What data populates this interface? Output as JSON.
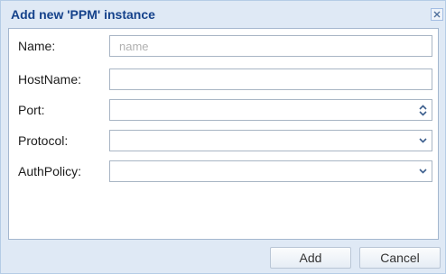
{
  "dialog": {
    "title": "Add new 'PPM' instance",
    "close_icon": "close-x-icon"
  },
  "form": {
    "fields": [
      {
        "label": "Name:",
        "type": "text",
        "value": "",
        "placeholder": "name"
      },
      {
        "label": "HostName:",
        "type": "text",
        "value": "",
        "placeholder": ""
      },
      {
        "label": "Port:",
        "type": "spinner",
        "value": "",
        "placeholder": ""
      },
      {
        "label": "Protocol:",
        "type": "combo",
        "value": "",
        "placeholder": ""
      },
      {
        "label": "AuthPolicy:",
        "type": "combo",
        "value": "",
        "placeholder": ""
      }
    ]
  },
  "buttons": {
    "add": "Add",
    "cancel": "Cancel"
  },
  "colors": {
    "title_text": "#15428b",
    "frame": "#dfe9f5",
    "field_border": "#a8b5c4"
  },
  "icons": {
    "spinner_up": "chevron-up-icon",
    "spinner_down": "chevron-down-icon",
    "combo_trigger": "chevron-down-icon"
  }
}
